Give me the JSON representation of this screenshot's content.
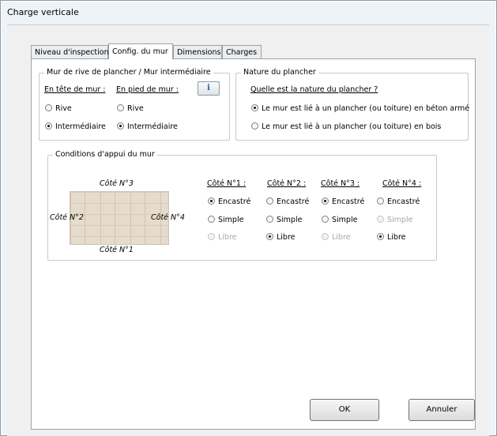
{
  "window": {
    "title": "Charge verticale"
  },
  "tabs": [
    {
      "label": "Niveau d'inspection",
      "active": false
    },
    {
      "label": "Config. du mur",
      "active": true
    },
    {
      "label": "Dimensions",
      "active": false
    },
    {
      "label": "Charges",
      "active": false
    }
  ],
  "mur_rive": {
    "legend": "Mur de rive de plancher / Mur intermédiaire",
    "tete_label": "En tête de mur :",
    "pied_label": "En pied de mur :",
    "info_label": "i",
    "tete_options": [
      {
        "label": "Rive",
        "checked": false
      },
      {
        "label": "Intermédiaire",
        "checked": true
      }
    ],
    "pied_options": [
      {
        "label": "Rive",
        "checked": false
      },
      {
        "label": "Intermédiaire",
        "checked": true
      }
    ]
  },
  "nature": {
    "legend": "Nature du plancher",
    "question": "Quelle est la nature du plancher ?",
    "options": [
      {
        "label": "Le mur est lié à un plancher (ou toiture) en béton armé",
        "checked": true
      },
      {
        "label": "Le mur est lié à un plancher (ou toiture) en bois",
        "checked": false
      }
    ]
  },
  "conditions": {
    "legend": "Conditions d'appui du mur",
    "diagram_labels": {
      "top": "Côté N°3",
      "left": "Côté N°2",
      "right": "Côté N°4",
      "bottom": "Côté N°1"
    },
    "columns": [
      {
        "header": "Côté N°1 :",
        "options": [
          {
            "label": "Encastré",
            "checked": true,
            "disabled": false
          },
          {
            "label": "Simple",
            "checked": false,
            "disabled": false
          },
          {
            "label": "Libre",
            "checked": false,
            "disabled": true
          }
        ]
      },
      {
        "header": "Côté N°2 :",
        "options": [
          {
            "label": "Encastré",
            "checked": false,
            "disabled": false
          },
          {
            "label": "Simple",
            "checked": false,
            "disabled": false
          },
          {
            "label": "Libre",
            "checked": true,
            "disabled": false
          }
        ]
      },
      {
        "header": "Côté N°3 :",
        "options": [
          {
            "label": "Encastré",
            "checked": true,
            "disabled": false
          },
          {
            "label": "Simple",
            "checked": false,
            "disabled": false
          },
          {
            "label": "Libre",
            "checked": false,
            "disabled": true
          }
        ]
      },
      {
        "header": "Côté N°4 :",
        "options": [
          {
            "label": "Encastré",
            "checked": false,
            "disabled": false
          },
          {
            "label": "Simple",
            "checked": false,
            "disabled": true
          },
          {
            "label": "Libre",
            "checked": true,
            "disabled": false
          }
        ]
      }
    ]
  },
  "buttons": {
    "ok": "OK",
    "cancel": "Annuler"
  }
}
